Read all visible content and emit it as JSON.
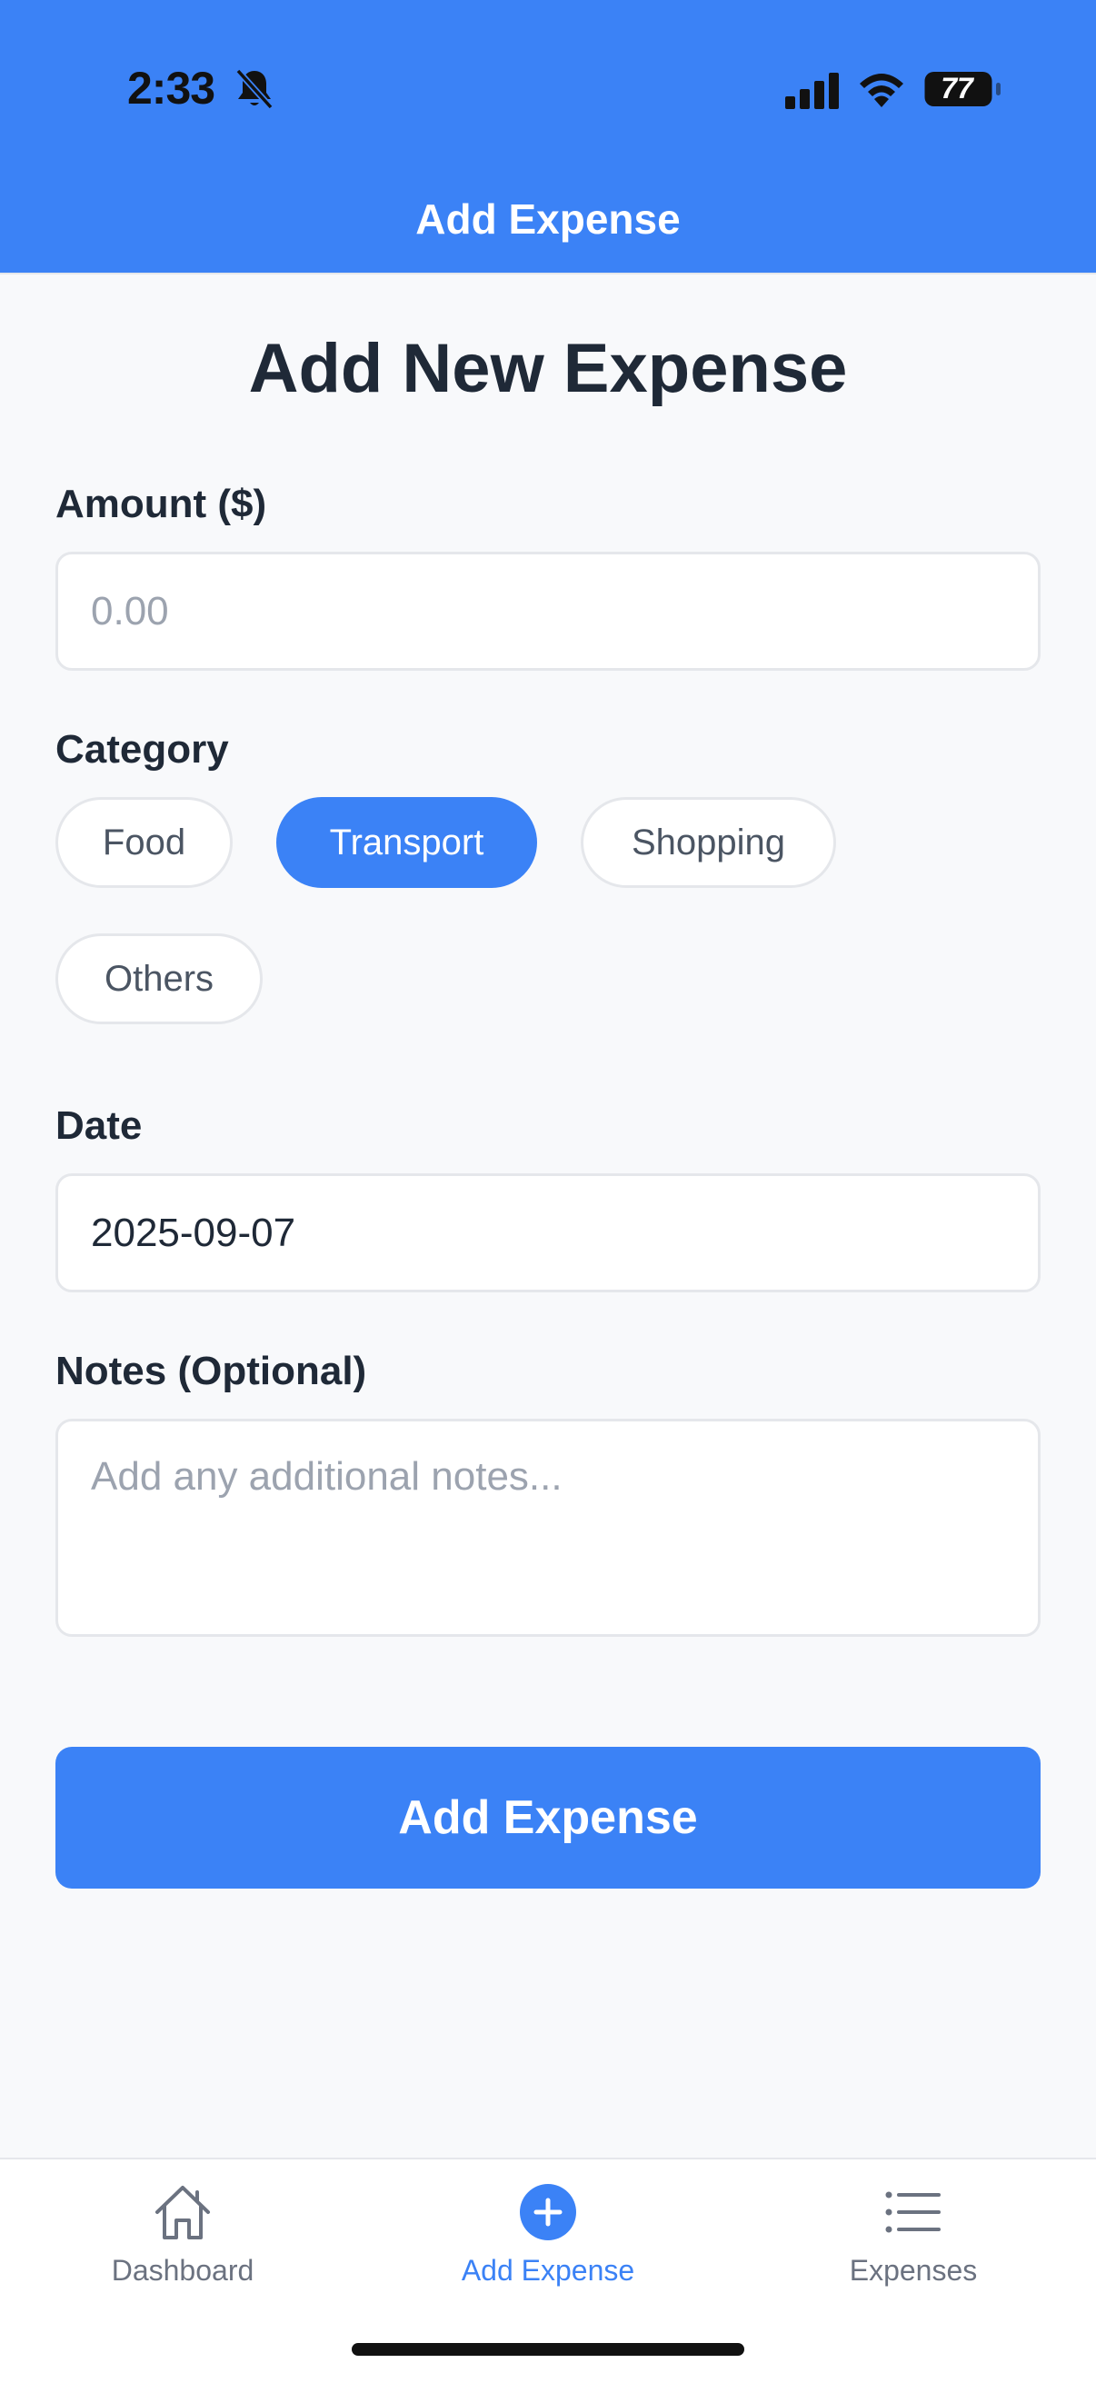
{
  "status_bar": {
    "time": "2:33",
    "battery": "77"
  },
  "header": {
    "title": "Add Expense"
  },
  "page": {
    "title": "Add New Expense"
  },
  "form": {
    "amount": {
      "label": "Amount ($)",
      "placeholder": "0.00",
      "value": ""
    },
    "category": {
      "label": "Category",
      "options": [
        "Food",
        "Transport",
        "Shopping",
        "Others"
      ],
      "selected": "Transport"
    },
    "date": {
      "label": "Date",
      "value": "2025-09-07"
    },
    "notes": {
      "label": "Notes (Optional)",
      "placeholder": "Add any additional notes...",
      "value": ""
    },
    "submit_label": "Add Expense"
  },
  "tabbar": {
    "items": [
      {
        "label": "Dashboard",
        "icon": "home-icon",
        "active": false
      },
      {
        "label": "Add Expense",
        "icon": "add-circle-icon",
        "active": true
      },
      {
        "label": "Expenses",
        "icon": "list-icon",
        "active": false
      }
    ]
  },
  "colors": {
    "accent": "#3b82f6",
    "background": "#f8f9fb",
    "text": "#1f2937",
    "muted": "#6b7280"
  }
}
